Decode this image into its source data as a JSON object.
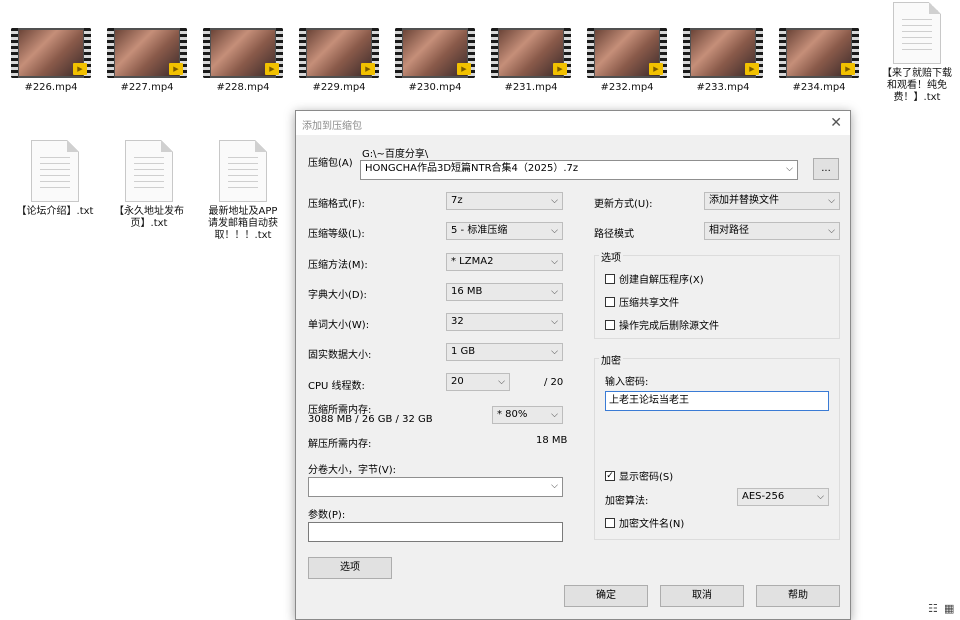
{
  "desktop": {
    "videos": [
      {
        "name": "#226.mp4"
      },
      {
        "name": "#227.mp4"
      },
      {
        "name": "#228.mp4"
      },
      {
        "name": "#229.mp4"
      },
      {
        "name": "#230.mp4"
      },
      {
        "name": "#231.mp4"
      },
      {
        "name": "#232.mp4"
      },
      {
        "name": "#233.mp4"
      },
      {
        "name": "#234.mp4"
      }
    ],
    "docs": [
      {
        "line1": "【来了就赔下载",
        "line2": "和观看！纯免",
        "line3": "费！】.txt"
      },
      {
        "line1": "【论坛介绍】.txt",
        "line2": "",
        "line3": ""
      },
      {
        "line1": "【永久地址发布",
        "line2": "页】.txt",
        "line3": ""
      },
      {
        "line1": "最新地址及APP",
        "line2": "请发邮箱自动获",
        "line3": "取！！！.txt"
      }
    ]
  },
  "dialog": {
    "title": "添加到压缩包",
    "archive_label": "压缩包(A)",
    "archive_path": "G:\\~百度分享\\",
    "archive_name": "HONGCHA作品3D短篇NTR合集4（2025）.7z",
    "browse_label": "...",
    "format_label": "压缩格式(F):",
    "format_value": "7z",
    "level_label": "压缩等级(L):",
    "level_value": "5 - 标准压缩",
    "method_label": "压缩方法(M):",
    "method_value": "* LZMA2",
    "dict_label": "字典大小(D):",
    "dict_value": "16 MB",
    "word_label": "单词大小(W):",
    "word_value": "32",
    "solid_label": "固实数据大小:",
    "solid_value": "1 GB",
    "cpu_label": "CPU 线程数:",
    "cpu_value": "20",
    "cpu_total": "/ 20",
    "mem_label": "压缩所需内存:",
    "mem_detail": "3088 MB / 26 GB / 32 GB",
    "mem_value": "* 80%",
    "dmem_label": "解压所需内存:",
    "dmem_value": "18 MB",
    "split_label": "分卷大小，字节(V):",
    "split_value": "",
    "params_label": "参数(P):",
    "params_value": "",
    "options_button": "选项",
    "update_label": "更新方式(U):",
    "update_value": "添加并替换文件",
    "path_label": "路径模式",
    "path_value": "相对路径",
    "options_group": "选项",
    "opt_sfx": "创建自解压程序(X)",
    "opt_shared": "压缩共享文件",
    "opt_delete": "操作完成后删除源文件",
    "encrypt_group": "加密",
    "password_label": "输入密码:",
    "password_value": "上老王论坛当老王",
    "show_password": "显示密码(S)",
    "enc_method_label": "加密算法:",
    "enc_method_value": "AES-256",
    "enc_names": "加密文件名(N)",
    "ok": "确定",
    "cancel": "取消",
    "help": "帮助"
  }
}
